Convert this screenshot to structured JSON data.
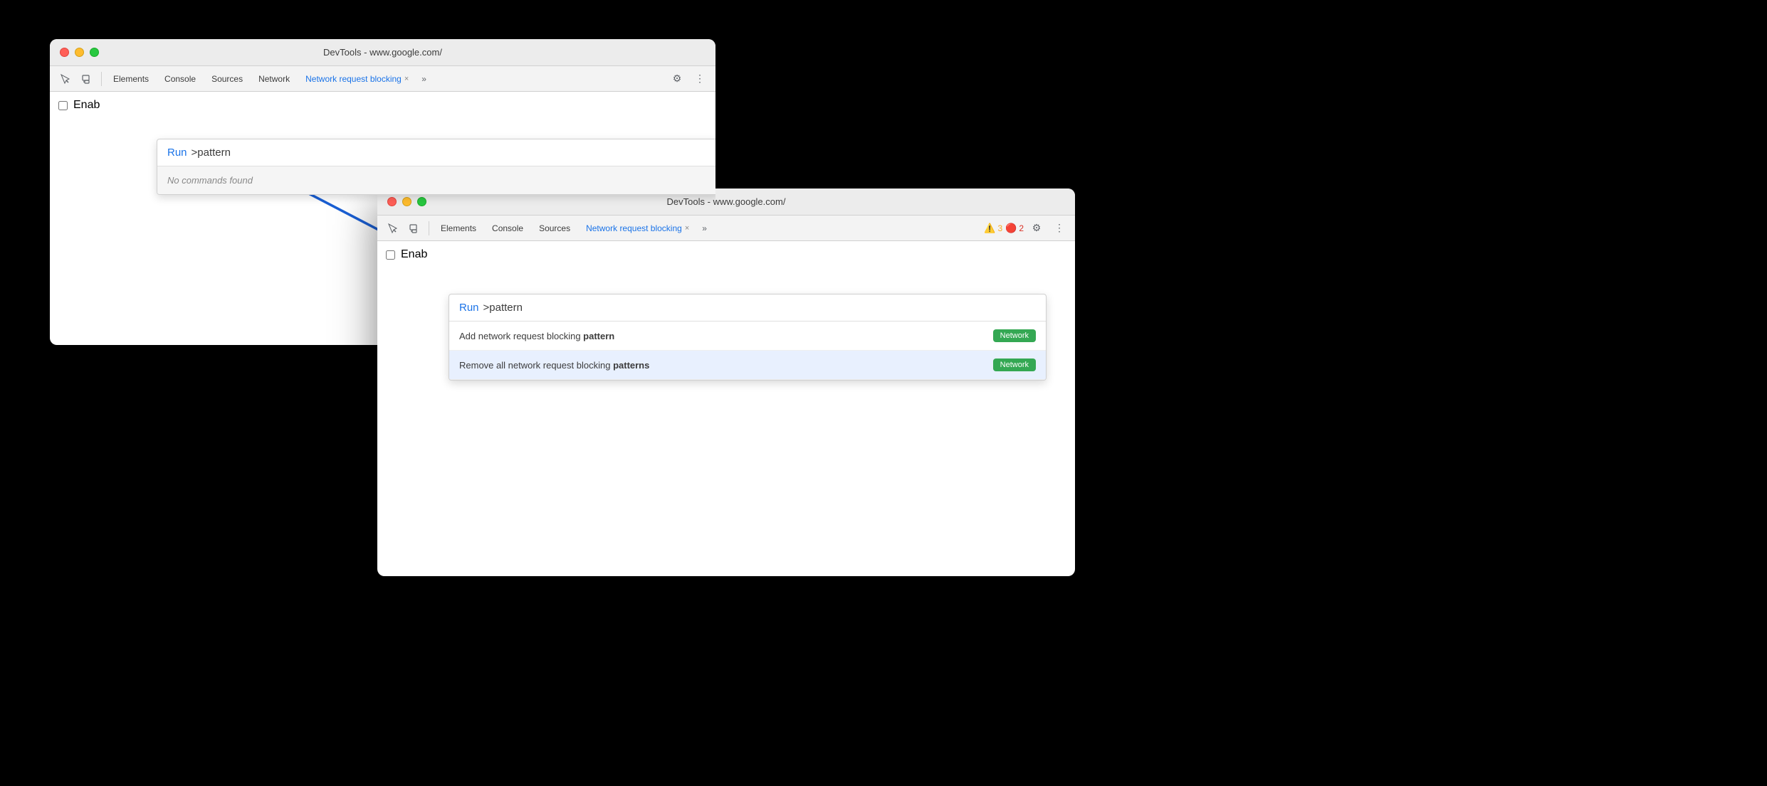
{
  "window1": {
    "title": "DevTools - www.google.com/",
    "controls": {
      "close": "close",
      "minimize": "minimize",
      "maximize": "maximize"
    },
    "toolbar": {
      "tabs": [
        {
          "label": "Elements",
          "active": false
        },
        {
          "label": "Console",
          "active": false
        },
        {
          "label": "Sources",
          "active": false
        },
        {
          "label": "Network",
          "active": false
        },
        {
          "label": "Network request blocking",
          "active": true
        }
      ],
      "more_tabs": "»"
    },
    "content": {
      "enable_label": "Enab"
    },
    "command_palette": {
      "run_label": "Run",
      "input_text": ">pattern",
      "no_commands_text": "No commands found"
    }
  },
  "window2": {
    "title": "DevTools - www.google.com/",
    "controls": {
      "close": "close",
      "minimize": "minimize",
      "maximize": "maximize"
    },
    "toolbar": {
      "tabs": [
        {
          "label": "Elements",
          "active": false
        },
        {
          "label": "Console",
          "active": false
        },
        {
          "label": "Sources",
          "active": false
        },
        {
          "label": "Network request blocking",
          "active": true
        }
      ],
      "more_tabs": "»",
      "warnings": {
        "icon": "⚠",
        "count": "3"
      },
      "errors": {
        "icon": "🛑",
        "count": "2"
      }
    },
    "content": {
      "enable_label": "Enab"
    },
    "command_palette": {
      "run_label": "Run",
      "input_text": ">pattern",
      "items": [
        {
          "text_before": "Add network request blocking ",
          "text_bold": "pattern",
          "text_after": "",
          "badge": "Network",
          "selected": false
        },
        {
          "text_before": "Remove all network request blocking ",
          "text_bold": "patterns",
          "text_after": "",
          "badge": "Network",
          "selected": true
        }
      ]
    }
  },
  "icons": {
    "inspect": "⬚",
    "device": "⬜",
    "gear": "⚙",
    "more": "⋮",
    "close_tab": "×"
  }
}
